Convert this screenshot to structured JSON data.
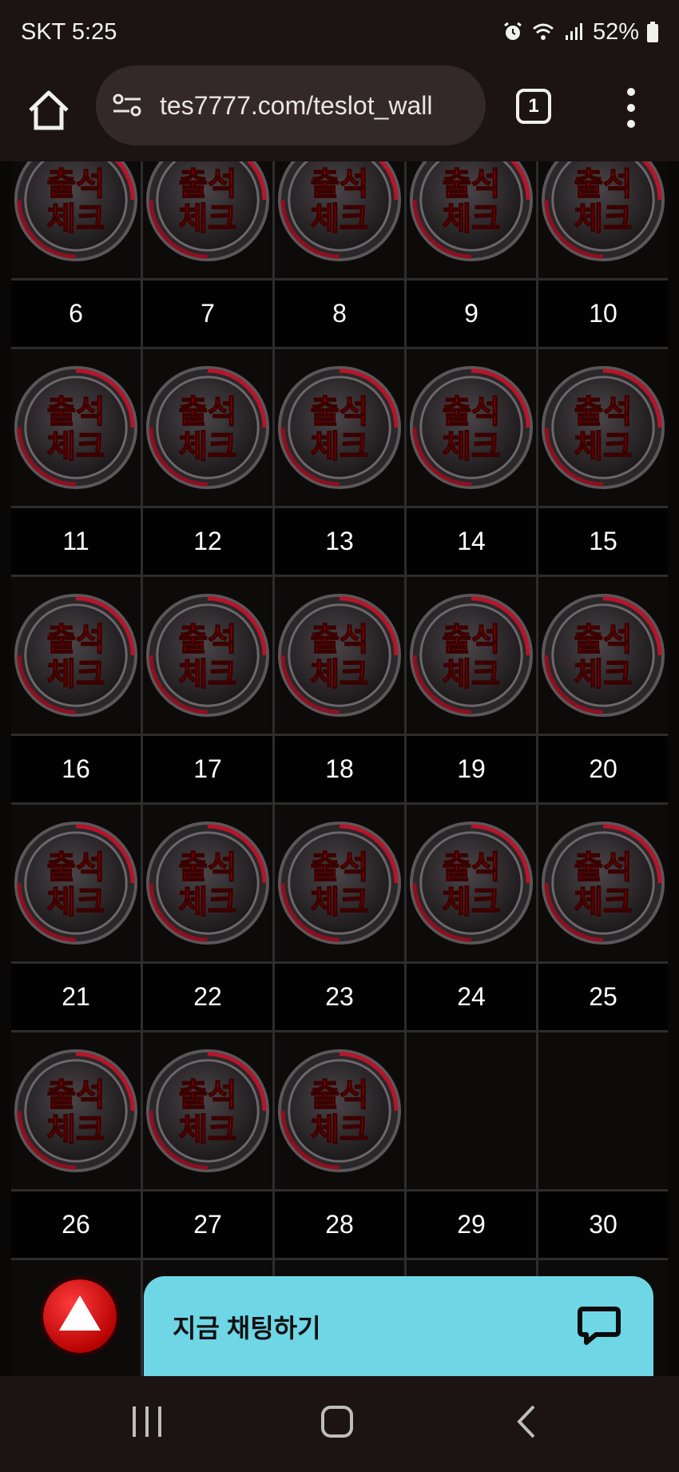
{
  "status_bar": {
    "carrier_time": "SKT 5:25",
    "battery": "52%"
  },
  "browser": {
    "url": "tes7777.com/teslot_wall",
    "tab_count": "1"
  },
  "badge_text": [
    "출석",
    "체크"
  ],
  "calendar": {
    "rows": [
      {
        "stamped": [
          true,
          true,
          true,
          true,
          true
        ],
        "days": [
          "6",
          "7",
          "8",
          "9",
          "10"
        ]
      },
      {
        "stamped": [
          true,
          true,
          true,
          true,
          true
        ],
        "days": [
          "11",
          "12",
          "13",
          "14",
          "15"
        ]
      },
      {
        "stamped": [
          true,
          true,
          true,
          true,
          true
        ],
        "days": [
          "16",
          "17",
          "18",
          "19",
          "20"
        ]
      },
      {
        "stamped": [
          true,
          true,
          true,
          true,
          true
        ],
        "days": [
          "21",
          "22",
          "23",
          "24",
          "25"
        ]
      },
      {
        "stamped": [
          true,
          true,
          true,
          false,
          false
        ],
        "days": [
          "26",
          "27",
          "28",
          "29",
          "30"
        ]
      },
      {
        "stamped": [
          false,
          false,
          false,
          false,
          false
        ],
        "days": [
          "",
          "",
          "",
          "",
          ""
        ]
      }
    ]
  },
  "chat": {
    "label": "지금 채팅하기"
  },
  "colors": {
    "accent_red": "#e00000",
    "chat_bg": "#6fd6e6"
  }
}
